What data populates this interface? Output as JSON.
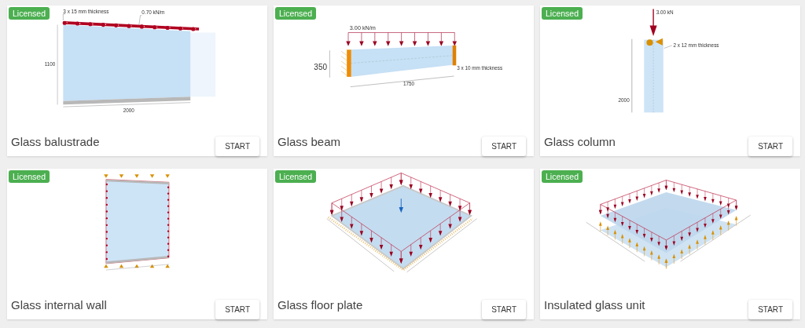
{
  "cards": [
    {
      "badge": "Licensed",
      "title": "Glass balustrade",
      "button": "START",
      "drawing": {
        "kind": "balustrade",
        "labels": [
          "3 x 15 mm thickness",
          "0.70 kN/m",
          "1100",
          "2000"
        ]
      }
    },
    {
      "badge": "Licensed",
      "title": "Glass beam",
      "button": "START",
      "drawing": {
        "kind": "beam",
        "labels": [
          "3.00 kN/m",
          "350",
          "1750",
          "3 x 10 mm thickness"
        ]
      }
    },
    {
      "badge": "Licensed",
      "title": "Glass column",
      "button": "START",
      "drawing": {
        "kind": "column",
        "labels": [
          "3.00 kN",
          "2 x 12 mm thickness",
          "2000"
        ]
      }
    },
    {
      "badge": "Licensed",
      "title": "Glass internal wall",
      "button": "START",
      "drawing": {
        "kind": "wall"
      }
    },
    {
      "badge": "Licensed",
      "title": "Glass floor plate",
      "button": "START",
      "drawing": {
        "kind": "plate"
      }
    },
    {
      "badge": "Licensed",
      "title": "Insulated glass unit",
      "button": "START",
      "drawing": {
        "kind": "igu"
      }
    }
  ]
}
